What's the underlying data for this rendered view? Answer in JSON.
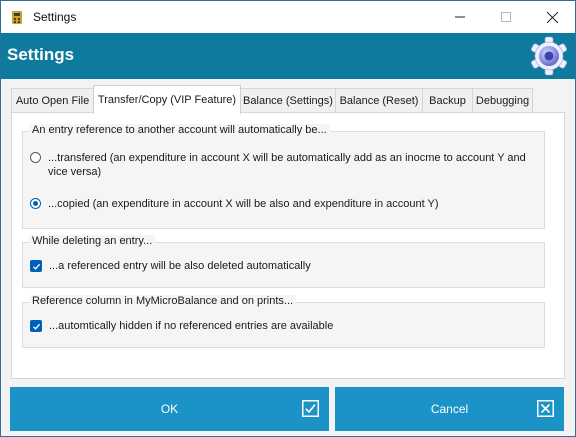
{
  "window": {
    "title": "Settings"
  },
  "header": {
    "title": "Settings"
  },
  "tabs": [
    {
      "label": "Auto Open File"
    },
    {
      "label": "Transfer/Copy (VIP Feature)"
    },
    {
      "label": "Balance (Settings)"
    },
    {
      "label": "Balance (Reset)"
    },
    {
      "label": "Backup"
    },
    {
      "label": "Debugging"
    }
  ],
  "active_tab": "Transfer/Copy (VIP Feature)",
  "groups": {
    "reference": {
      "legend": "An entry reference to another account will automatically be...",
      "options": [
        {
          "label": "...transfered (an expenditure in account X will be automatically add as an inocme to account Y and vice versa)",
          "checked": false
        },
        {
          "label": "...copied (an expenditure in account X will be also and expenditure in account Y)",
          "checked": true
        }
      ]
    },
    "deleting": {
      "legend": "While deleting an entry...",
      "checkbox": {
        "label": "...a referenced entry will be also deleted automatically",
        "checked": true
      }
    },
    "column": {
      "legend": "Reference column in MyMicroBalance and on prints...",
      "checkbox": {
        "label": "...automtically hidden if no referenced entries are available",
        "checked": true
      }
    }
  },
  "buttons": {
    "ok": "OK",
    "cancel": "Cancel"
  },
  "colors": {
    "header": "#0e7a9e",
    "button": "#1b93c7",
    "accent": "#005fb8"
  }
}
